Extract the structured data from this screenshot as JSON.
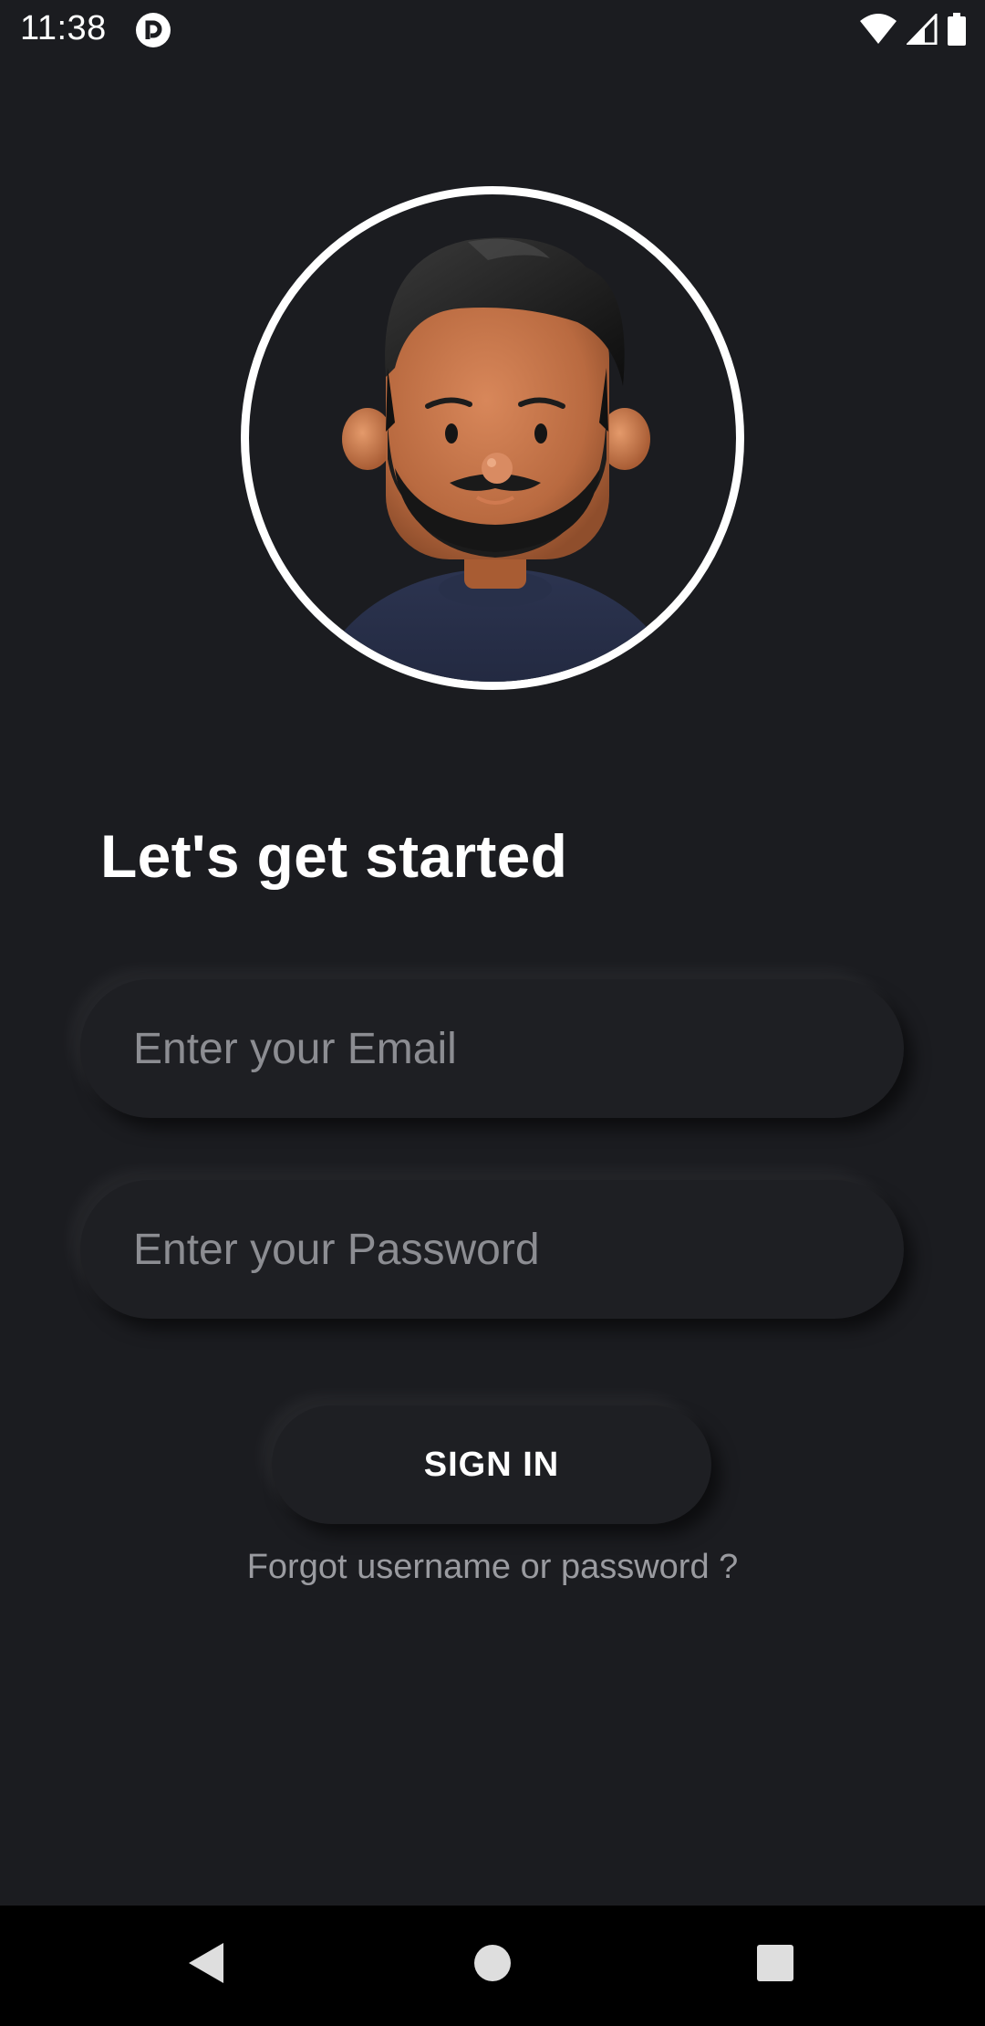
{
  "status_bar": {
    "time": "11:38",
    "icons": [
      "notification-app-icon",
      "wifi-icon",
      "cellular-signal-icon",
      "battery-icon"
    ]
  },
  "avatar": {
    "icon": "user-avatar-illustration",
    "ring_color": "#ffffff"
  },
  "login": {
    "heading": "Let's get started",
    "email_placeholder": "Enter your Email",
    "password_placeholder": "Enter your Password",
    "signin_label": "SIGN IN",
    "forgot_label": "Forgot username or password ?"
  },
  "nav_bar": {
    "icons": [
      "back-icon",
      "home-icon",
      "recents-icon"
    ]
  },
  "colors": {
    "background": "#1b1c20",
    "text_primary": "#ffffff",
    "text_muted": "#9a9ba0",
    "nav_bar": "#000000"
  }
}
